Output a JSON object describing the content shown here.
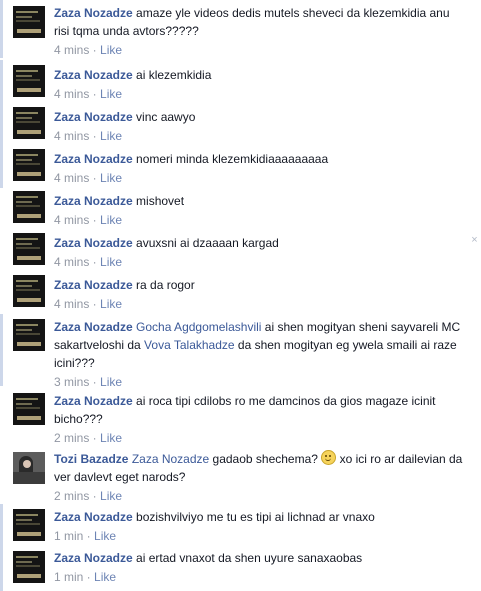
{
  "comments": [
    {
      "author": "Zaza Nozadze",
      "text": "amaze yle videos dedis mutels sheveci da klezemkidia anu risi tqma unda avtors?????",
      "time": "4 mins",
      "like": "Like"
    },
    {
      "author": "Zaza Nozadze",
      "text": "ai klezemkidia",
      "time": "4 mins",
      "like": "Like"
    },
    {
      "author": "Zaza Nozadze",
      "text": "vinc aawyo",
      "time": "4 mins",
      "like": "Like"
    },
    {
      "author": "Zaza Nozadze",
      "text": "nomeri minda klezemkidiaaaaaaaaa",
      "time": "4 mins",
      "like": "Like"
    },
    {
      "author": "Zaza Nozadze",
      "text": "mishovet",
      "time": "4 mins",
      "like": "Like"
    },
    {
      "author": "Zaza Nozadze",
      "text": "avuxsni ai dzaaaan kargad",
      "time": "4 mins",
      "like": "Like",
      "remove": "×"
    },
    {
      "author": "Zaza Nozadze",
      "text": "ra da rogor",
      "time": "4 mins",
      "like": "Like"
    },
    {
      "author": "Zaza Nozadze",
      "tag1": "Gocha Agdgomelashvili",
      "text1": " ai shen mogityan sheni sayvareli MC sakartveloshi da ",
      "tag2": "Vova Talakhadze",
      "text2": " da shen mogityan eg ywela smaili ai raze icini???",
      "time": "3 mins",
      "like": "Like"
    },
    {
      "author": "Zaza Nozadze",
      "text": "ai roca tipi cdilobs ro me damcinos da gios magaze icinit bicho???",
      "time": "2 mins",
      "like": "Like"
    },
    {
      "author": "Tozi Bazadze",
      "tag1": "Zaza Nozadze",
      "text1": " gadaob shechema? ",
      "text2": " xo ici ro ar dailevian da ver davlevt eget narods?",
      "time": "2 mins",
      "like": "Like"
    },
    {
      "author": "Zaza Nozadze",
      "text": "bozishvilviyo me tu es tipi ai lichnad ar vnaxo",
      "time": "1 min",
      "like": "Like"
    },
    {
      "author": "Zaza Nozadze",
      "text": "ai ertad vnaxot da shen uyure sanaxaobas",
      "time": "1 min",
      "like": "Like"
    }
  ]
}
